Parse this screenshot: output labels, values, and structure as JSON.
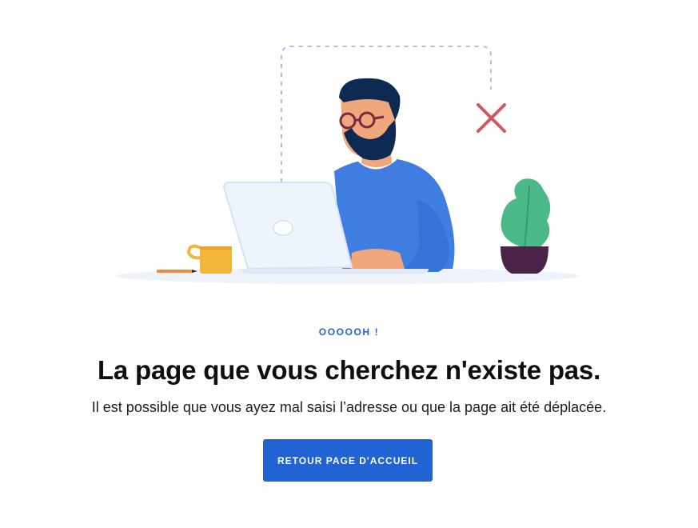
{
  "error": {
    "eyebrow": "OOOOOH !",
    "headline": "La page que vous cherchez n'existe pas.",
    "description": "Il est possible que vous ayez mal saisi l’adresse ou que la page ait été déplacée.",
    "button_label": "RETOUR PAGE D'ACCUEIL"
  },
  "illustration": {
    "elements": [
      "man-with-glasses",
      "laptop-icon",
      "mug-icon",
      "pencil-icon",
      "plant-icon",
      "close-icon",
      "dashed-frame"
    ],
    "colors": {
      "accent": "#2263d4",
      "shirt": "#3f7ee0",
      "hair": "#0f2a52",
      "mug": "#f3b63c",
      "plant": "#4cb98b",
      "pot": "#4a2346",
      "cross": "#cc5a63",
      "laptop": "#eef4fc"
    }
  }
}
